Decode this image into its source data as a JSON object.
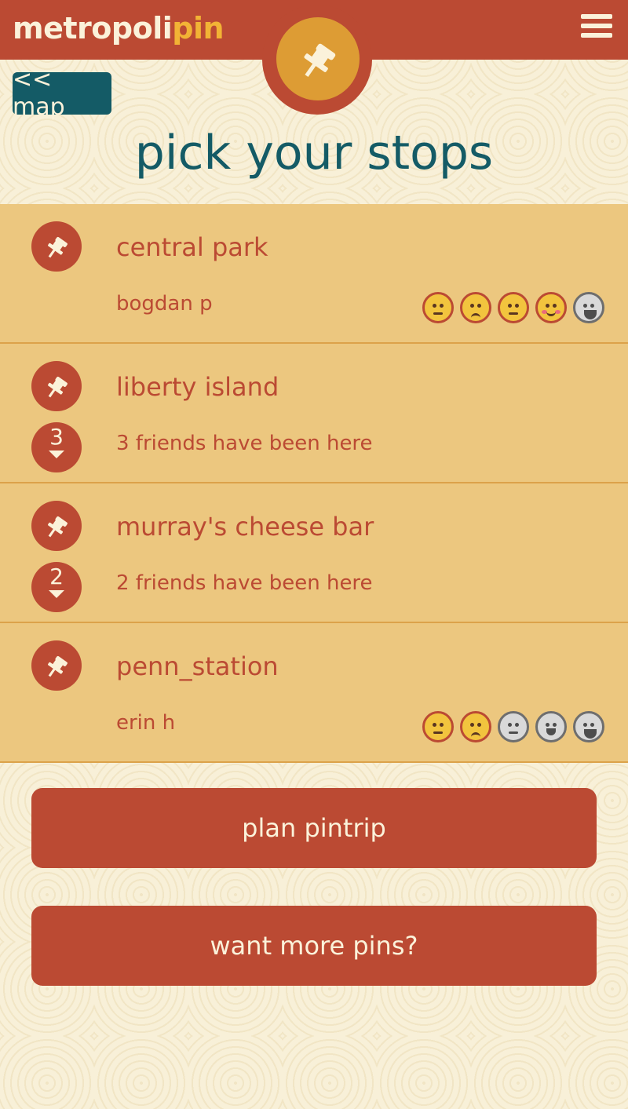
{
  "brand": {
    "name_part1": "metropoli",
    "name_part2": "pin"
  },
  "nav": {
    "back_label": "<< map"
  },
  "page": {
    "title": "pick your stops"
  },
  "stops": [
    {
      "name": "central park",
      "subtitle": "bogdan p",
      "rating": 4
    },
    {
      "name": "liberty island",
      "subtitle": "3 friends have been here",
      "friends_count": "3"
    },
    {
      "name": "murray's cheese bar",
      "subtitle": "2 friends have been here",
      "friends_count": "2"
    },
    {
      "name": "penn_station",
      "subtitle": "erin h",
      "rating": 2
    }
  ],
  "rating_icons": [
    "unamused-face-icon",
    "frowning-face-icon",
    "neutral-face-icon",
    "blush-face-icon",
    "grinning-face-icon"
  ],
  "actions": {
    "plan_label": "plan pintrip",
    "more_label": "want more pins?"
  },
  "colors": {
    "brand_red": "#bb4a33",
    "brand_gold": "#f2b335",
    "teal": "#145b66",
    "row_bg": "#ecc77f",
    "cream": "#fbf2da"
  }
}
